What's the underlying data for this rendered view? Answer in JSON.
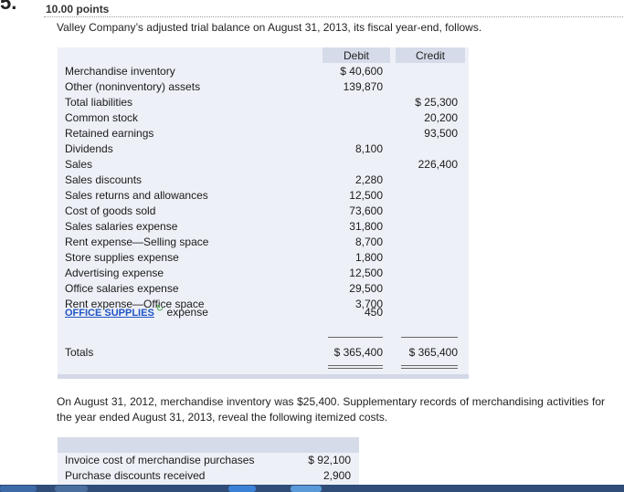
{
  "question": {
    "number_mark": "5.",
    "points": "10.00 points",
    "prompt": "Valley Company’s adjusted trial balance on August 31, 2013, its fiscal year-end, follows."
  },
  "trial_balance": {
    "header": {
      "debit": "Debit",
      "credit": "Credit"
    },
    "rows": [
      {
        "label": "Merchandise inventory",
        "debit": "$  40,600",
        "credit": ""
      },
      {
        "label": "Other (noninventory) assets",
        "debit": "139,870",
        "credit": ""
      },
      {
        "label": "Total liabilities",
        "debit": "",
        "credit": "$  25,300"
      },
      {
        "label": "Common stock",
        "debit": "",
        "credit": "20,200"
      },
      {
        "label": "Retained earnings",
        "debit": "",
        "credit": "93,500"
      },
      {
        "label": "Dividends",
        "debit": "8,100",
        "credit": ""
      },
      {
        "label": "Sales",
        "debit": "",
        "credit": "226,400"
      },
      {
        "label": "Sales discounts",
        "debit": "2,280",
        "credit": ""
      },
      {
        "label": "Sales returns and allowances",
        "debit": "12,500",
        "credit": ""
      },
      {
        "label": "Cost of goods sold",
        "debit": "73,600",
        "credit": ""
      },
      {
        "label": "Sales salaries expense",
        "debit": "31,800",
        "credit": ""
      },
      {
        "label": "Rent expense—Selling space",
        "debit": "8,700",
        "credit": ""
      },
      {
        "label": "Store supplies expense",
        "debit": "1,800",
        "credit": ""
      },
      {
        "label": "Advertising expense",
        "debit": "12,500",
        "credit": ""
      },
      {
        "label": "Office salaries expense",
        "debit": "29,500",
        "credit": ""
      },
      {
        "label": "Rent expense—Office space",
        "debit": "3,700",
        "credit": ""
      }
    ],
    "office_supplies_row": {
      "link_text": "OFFICE SUPPLIES",
      "label_suffix": "expense",
      "debit": "450"
    },
    "totals": {
      "label": "Totals",
      "debit": "$ 365,400",
      "credit": "$ 365,400"
    }
  },
  "paragraph": "On August 31, 2012, merchandise inventory was $25,400. Supplementary records of merchandising activities for the year ended August 31, 2013, reveal the following itemized costs.",
  "costs": {
    "rows": [
      {
        "label": "Invoice cost of merchandise purchases",
        "value": "$ 92,100"
      },
      {
        "label": "Purchase discounts received",
        "value": "2,900"
      }
    ]
  },
  "icons": {
    "edit": "edit-pencil-icon"
  },
  "colors": {
    "table_bg": "#eef0f7",
    "header_bg": "#d5dbe9",
    "link": "#1f54c4",
    "taskbar": "#2f4d78"
  }
}
